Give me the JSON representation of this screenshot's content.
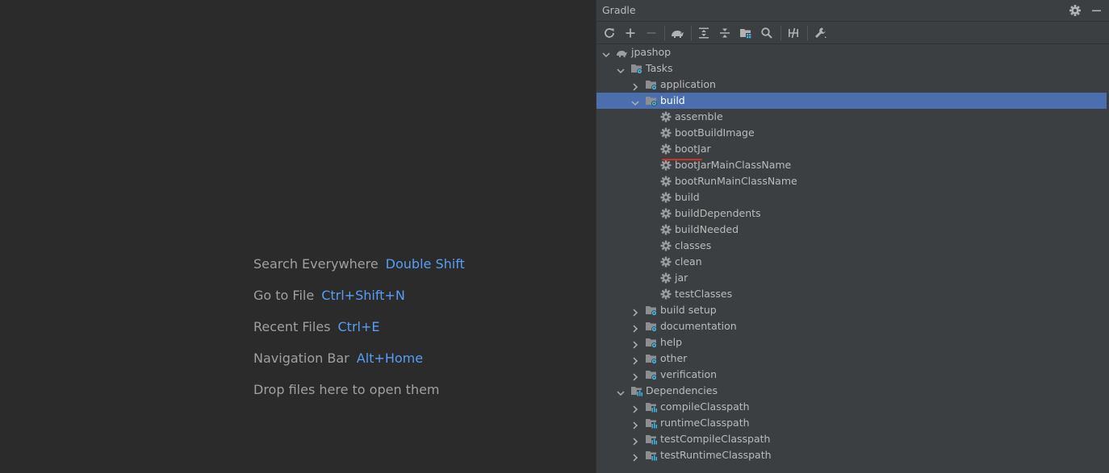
{
  "editor": {
    "hints": [
      {
        "text": "Search Everywhere",
        "key": "Double Shift"
      },
      {
        "text": "Go to File",
        "key": "Ctrl+Shift+N"
      },
      {
        "text": "Recent Files",
        "key": "Ctrl+E"
      },
      {
        "text": "Navigation Bar",
        "key": "Alt+Home"
      }
    ],
    "drop_text": "Drop files here to open them"
  },
  "gradle": {
    "title": "Gradle",
    "header_icons": [
      "gear-icon",
      "minimize-icon"
    ],
    "toolbar": [
      "reload-icon",
      "add-icon",
      "remove-icon",
      "elephant-icon",
      "expand-all-icon",
      "collapse-all-icon",
      "group-tasks-icon",
      "search-icon",
      "toggle-offline-icon",
      "settings-wrench-icon"
    ],
    "tree": {
      "project": "jpashop",
      "tasks_label": "Tasks",
      "task_groups": {
        "application": "application",
        "build": "build",
        "build_setup": "build setup",
        "documentation": "documentation",
        "help": "help",
        "other": "other",
        "verification": "verification"
      },
      "build_tasks": [
        "assemble",
        "bootBuildImage",
        "bootJar",
        "bootJarMainClassName",
        "bootRunMainClassName",
        "build",
        "buildDependents",
        "buildNeeded",
        "classes",
        "clean",
        "jar",
        "testClasses"
      ],
      "dependencies_label": "Dependencies",
      "dependencies": [
        "compileClasspath",
        "runtimeClasspath",
        "testCompileClasspath",
        "testRuntimeClasspath"
      ],
      "selected": "build"
    }
  },
  "colors": {
    "editor_bg": "#2b2b2b",
    "panel_bg": "#3c3f41",
    "selection": "#4b6eaf",
    "key_blue": "#589df6",
    "error_underline": "#d0312d"
  }
}
